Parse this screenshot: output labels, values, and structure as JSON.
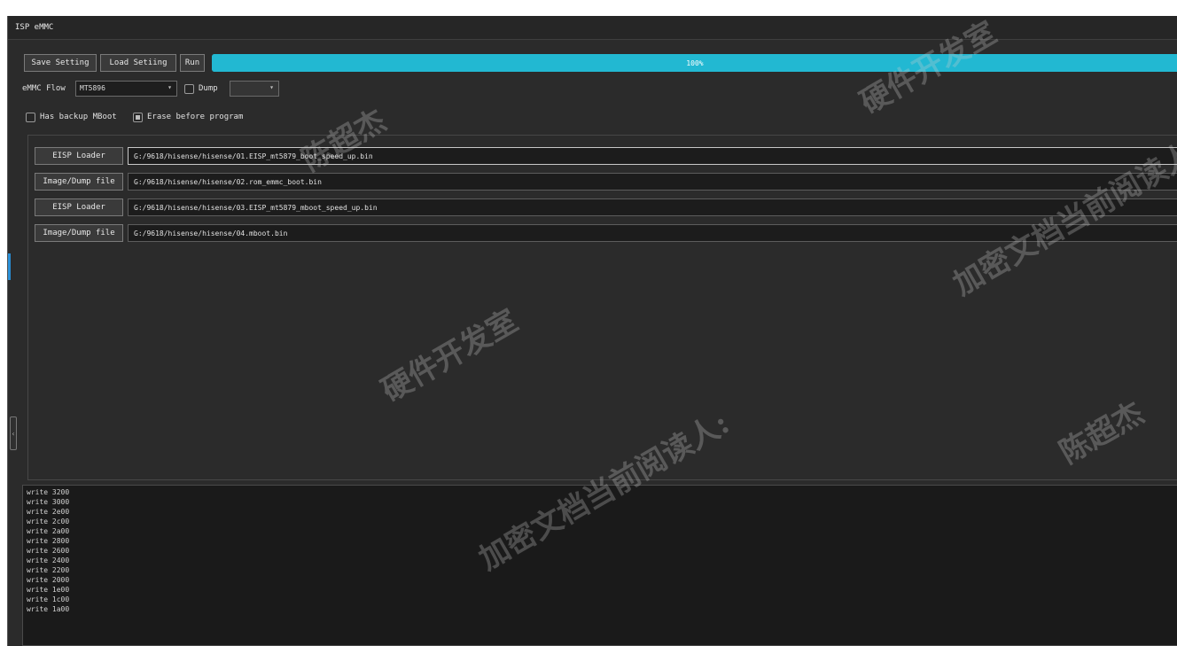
{
  "window": {
    "title": "ISP eMMC"
  },
  "toolbar": {
    "save_label": "Save Setting",
    "load_label": "Load Setiing",
    "run_label": "Run"
  },
  "progress": {
    "percent": 100,
    "text": "100%"
  },
  "options": {
    "emmc_flow_label": "eMMC Flow",
    "emmc_flow_value": "MT5896",
    "dump_label": "Dump",
    "dump_checked": false,
    "dump_select_value": "",
    "has_backup_label": "Has backup MBoot",
    "has_backup_checked": false,
    "erase_label": "Erase before program",
    "erase_checked": true
  },
  "files": [
    {
      "button": "EISP Loader",
      "path": "G:/9618/hisense/hisense/01.EISP_mt5879_boot_speed_up.bin"
    },
    {
      "button": "Image/Dump file",
      "path": "G:/9618/hisense/hisense/02.rom_emmc_boot.bin"
    },
    {
      "button": "EISP Loader",
      "path": "G:/9618/hisense/hisense/03.EISP_mt5879_mboot_speed_up.bin"
    },
    {
      "button": "Image/Dump file",
      "path": "G:/9618/hisense/hisense/04.mboot.bin"
    }
  ],
  "log": {
    "lines": [
      "write 3200",
      "write 3000",
      "write 2e00",
      "write 2c00",
      "write 2a00",
      "write 2800",
      "write 2600",
      "write 2400",
      "write 2200",
      "write 2000",
      "write 1e00",
      "write 1c00",
      "write 1a00"
    ]
  },
  "watermarks": {
    "a": "硬件开发室",
    "b": "陈超杰",
    "c": "加密文档当前阅读人:",
    "d": "陈超杰",
    "e": "加密文档当前阅读人:",
    "f": "硬件开发室",
    "g": "加密文档当前阅读人:"
  },
  "colors": {
    "accent": "#22b8d2",
    "background": "#2b2b2b",
    "log_background": "#1a1a1a"
  },
  "icons": {
    "dropdown": "chevron-down-icon",
    "side_handle": "chevron-left-icon"
  }
}
